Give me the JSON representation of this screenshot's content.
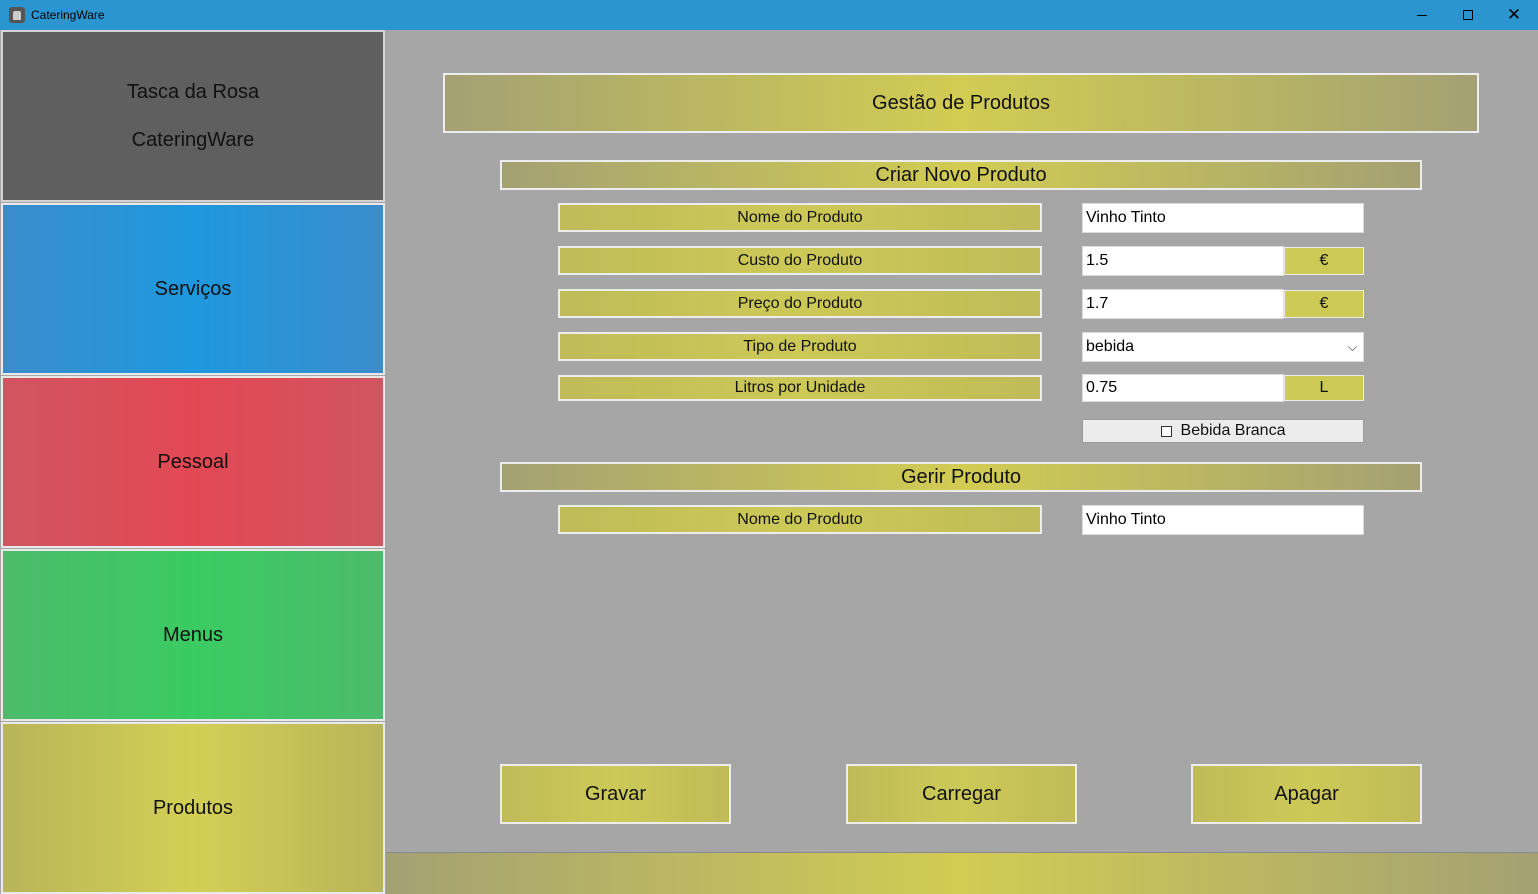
{
  "window": {
    "title": "CateringWare",
    "icon": "app-icon",
    "controls": {
      "minimize": "minimize-icon",
      "maximize": "maximize-icon",
      "close": "close-icon"
    }
  },
  "sidebar": {
    "brand": {
      "line1": "Tasca da Rosa",
      "line2": "CateringWare"
    },
    "items": [
      {
        "label": "Serviços",
        "color": "#1e98de"
      },
      {
        "label": "Pessoal",
        "color": "#e34853"
      },
      {
        "label": "Menus",
        "color": "#3acb62"
      },
      {
        "label": "Produtos",
        "color": "#d3cf55"
      }
    ]
  },
  "main": {
    "header": "Gestão de Produtos",
    "create_section": {
      "title": "Criar Novo Produto",
      "fields": {
        "name": {
          "label": "Nome do Produto",
          "value": "Vinho Tinto"
        },
        "cost": {
          "label": "Custo do Produto",
          "value": "1.5",
          "unit": "€"
        },
        "price": {
          "label": "Preço do Produto",
          "value": "1.7",
          "unit": "€"
        },
        "type": {
          "label": "Tipo de Produto",
          "value": "bebida"
        },
        "liters": {
          "label": "Litros por Unidade",
          "value": "0.75",
          "unit": "L"
        }
      },
      "checkbox": {
        "label": "Bebida Branca",
        "checked": false
      }
    },
    "manage_section": {
      "title": "Gerir Produto",
      "fields": {
        "name": {
          "label": "Nome do Produto",
          "value": "Vinho Tinto"
        }
      }
    },
    "actions": {
      "save": "Gravar",
      "load": "Carregar",
      "delete": "Apagar"
    }
  },
  "colors": {
    "titlebar": "#2b95cf",
    "background": "#a6a6a6",
    "gold_accent": "#d2cc53",
    "brand_tile": "#5f5f5f"
  }
}
